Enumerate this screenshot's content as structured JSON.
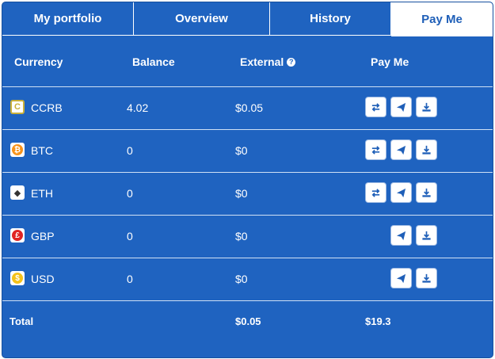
{
  "tabs": [
    {
      "label": "My portfolio"
    },
    {
      "label": "Overview"
    },
    {
      "label": "History"
    },
    {
      "label": "Pay Me",
      "active": true
    }
  ],
  "table": {
    "headers": {
      "currency": "Currency",
      "balance": "Balance",
      "external": "External",
      "payme": "Pay Me"
    },
    "help_glyph": "?",
    "rows": [
      {
        "currency": "CCRB",
        "balance": "4.02",
        "external": "$0.05",
        "icon": "ccrb-icon",
        "glyph": "C",
        "has_exchange": true
      },
      {
        "currency": "BTC",
        "balance": "0",
        "external": "$0",
        "icon": "bitcoin-icon",
        "glyph": "₿",
        "has_exchange": true
      },
      {
        "currency": "ETH",
        "balance": "0",
        "external": "$0",
        "icon": "ethereum-icon",
        "glyph": "◆",
        "has_exchange": true
      },
      {
        "currency": "GBP",
        "balance": "0",
        "external": "$0",
        "icon": "pound-icon",
        "glyph": "£",
        "has_exchange": false
      },
      {
        "currency": "USD",
        "balance": "0",
        "external": "$0",
        "icon": "dollar-icon",
        "glyph": "$",
        "has_exchange": false
      }
    ],
    "total": {
      "label": "Total",
      "external": "$0.05",
      "payme": "$19.3"
    }
  },
  "colors": {
    "panel_bg": "#1f63c0",
    "active_tab_text": "#1f5fb8",
    "button_icon": "#1f5fb8"
  }
}
